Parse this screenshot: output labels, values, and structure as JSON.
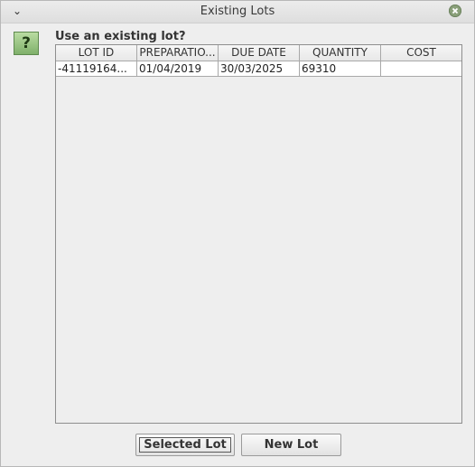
{
  "window": {
    "title": "Existing Lots",
    "menu_icon": "chevron-down-icon",
    "close_icon": "close-icon"
  },
  "dialog": {
    "icon": "question-icon",
    "icon_glyph": "?",
    "prompt": "Use an existing lot?"
  },
  "table": {
    "columns": [
      "LOT ID",
      "PREPARATIO...",
      "DUE DATE",
      "QUANTITY",
      "COST"
    ],
    "rows": [
      [
        "-41119164...",
        "01/04/2019",
        "30/03/2025",
        "69310",
        ""
      ]
    ]
  },
  "buttons": {
    "selected_lot": "Selected Lot",
    "new_lot": "New Lot"
  },
  "colors": {
    "icon_green": "#7fb06a",
    "close_button": "#8aa07a"
  }
}
